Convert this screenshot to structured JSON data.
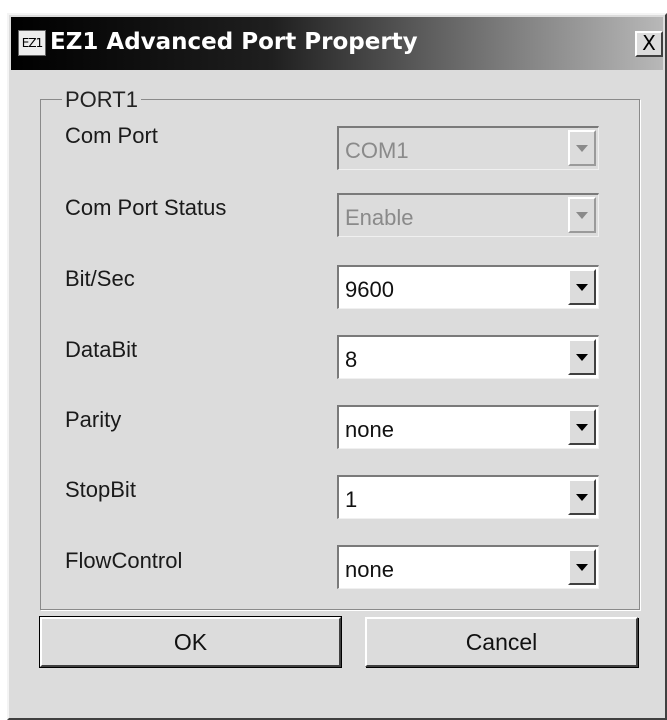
{
  "window": {
    "title": "EZ1 Advanced Port Property",
    "icon_text": "EZ1",
    "close_symbol": "X"
  },
  "group": {
    "title": "PORT1"
  },
  "fields": [
    {
      "label": "Com Port",
      "value": "COM1",
      "enabled": false
    },
    {
      "label": "Com Port Status",
      "value": "Enable",
      "enabled": false
    },
    {
      "label": "Bit/Sec",
      "value": "9600",
      "enabled": true
    },
    {
      "label": "DataBit",
      "value": "8",
      "enabled": true
    },
    {
      "label": "Parity",
      "value": "none",
      "enabled": true
    },
    {
      "label": "StopBit",
      "value": "1",
      "enabled": true
    },
    {
      "label": "FlowControl",
      "value": "none",
      "enabled": true
    }
  ],
  "buttons": {
    "ok": "OK",
    "cancel": "Cancel"
  },
  "icons": {
    "dropdown": "chevron-down-icon",
    "close": "close-icon",
    "app": "app-icon"
  },
  "colors": {
    "face": "#dcdcdc",
    "title_start": "#000000",
    "title_end": "#b8b8b8"
  }
}
